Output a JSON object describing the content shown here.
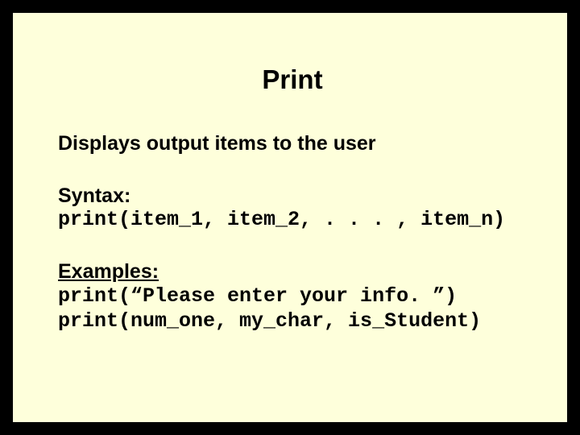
{
  "title": "Print",
  "subtitle": "Displays output items to the user",
  "syntax": {
    "label": "Syntax:",
    "code": "print(item_1, item_2, . . . , item_n)"
  },
  "examples": {
    "label": "Examples:",
    "code1": "print(“Please enter your info. ”)",
    "code2": "print(num_one, my_char, is_Student)"
  }
}
